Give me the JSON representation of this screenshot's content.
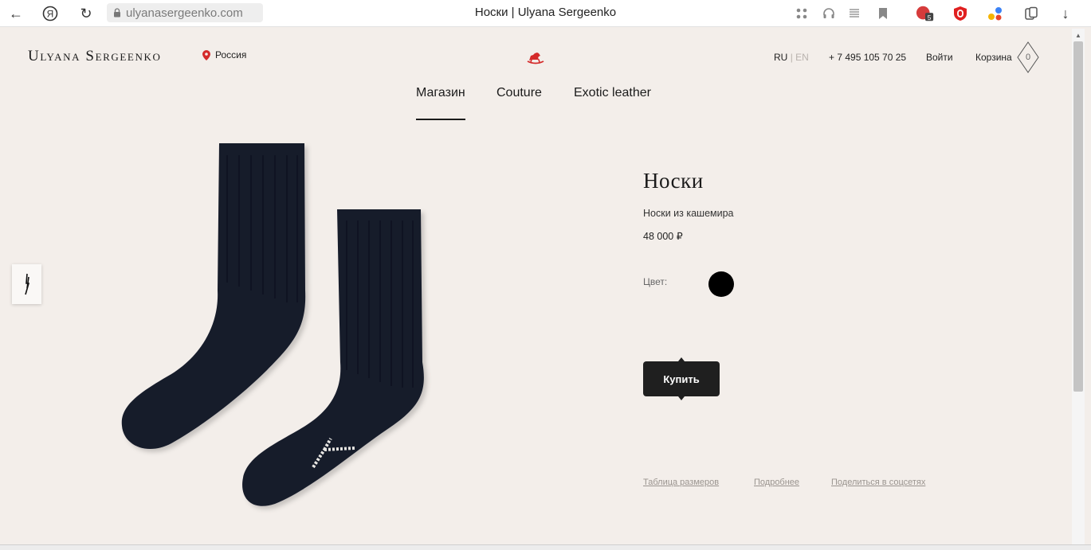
{
  "browser": {
    "url": "ulyanasergeenko.com",
    "tab_title": "Носки | Ulyana Sergeenko",
    "yandex_glyph": "Я",
    "back_glyph": "←",
    "reload_glyph": "↻",
    "download_glyph": "↓",
    "ext_badge_count": "5"
  },
  "header": {
    "logo": "Ulyana Sergeenko",
    "region": "Россия",
    "lang_active": "RU",
    "lang_sep": "|",
    "lang_inactive": "EN",
    "phone": "+ 7 495 105 70 25",
    "login": "Войти",
    "cart_label": "Корзина",
    "cart_count": "0"
  },
  "nav": {
    "items": [
      "Магазин",
      "Couture",
      "Exotic leather"
    ]
  },
  "product": {
    "title": "Носки",
    "description": "Носки из кашемира",
    "price": "48 000 ₽",
    "color_label": "Цвет:",
    "color_value": "#000000",
    "buy_label": "Купить"
  },
  "links": {
    "size_table": "Таблица размеров",
    "more": "Подробнее",
    "share": "Поделиться в соцсетях"
  },
  "colors": {
    "background": "#f3eeea",
    "accent_red": "#d42a2a",
    "button_dark": "#1f1f1f"
  }
}
